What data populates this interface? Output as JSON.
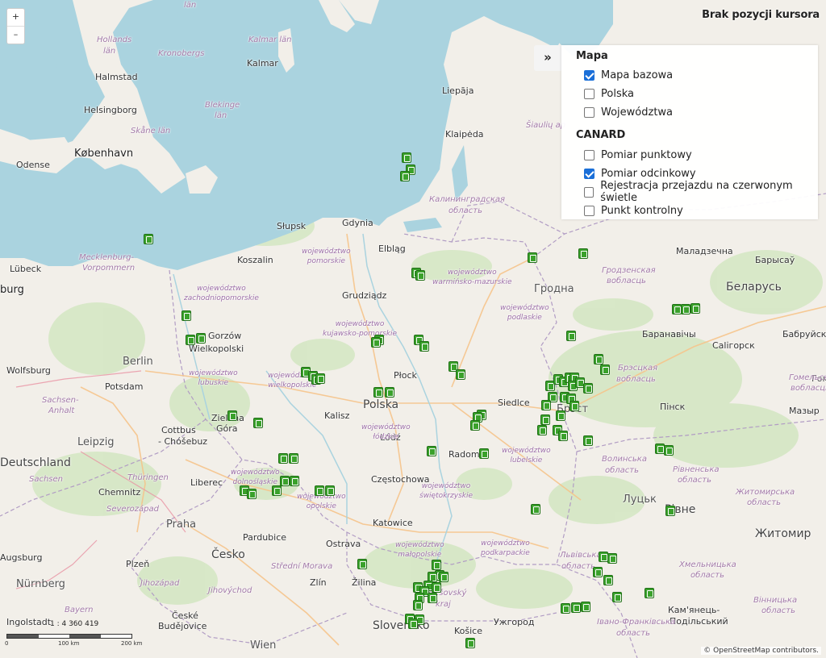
{
  "cursor_info": "Brak pozycji kursora",
  "zoom": {
    "in": "+",
    "out": "–"
  },
  "layer_panel": {
    "toggle": "»",
    "groups": [
      {
        "title": "Mapa",
        "items": [
          {
            "label": "Mapa bazowa",
            "checked": true
          },
          {
            "label": "Polska",
            "checked": false
          },
          {
            "label": "Województwa",
            "checked": false
          }
        ]
      },
      {
        "title": "CANARD",
        "items": [
          {
            "label": "Pomiar punktowy",
            "checked": false
          },
          {
            "label": "Pomiar odcinkowy",
            "checked": true
          },
          {
            "label": "Rejestracja przejazdu na czerwonym świetle",
            "checked": false
          },
          {
            "label": "Punkt kontrolny",
            "checked": false
          }
        ]
      }
    ]
  },
  "scale": {
    "ratio": "1 : 4 360 419",
    "labels": [
      "0",
      "100 km",
      "200 km"
    ]
  },
  "attribution": "© OpenStreetMap contributors.",
  "map_labels": {
    "seas": [
      "Hollands",
      "Kronobergs",
      "Kalmar län",
      "Halmstad",
      "Kalmar",
      "Helsingborg",
      "Blekinge",
      "län",
      "Skåne län",
      "København",
      "Odense",
      "Liepāja",
      "Klaipėda",
      "Šiaulių ap",
      "Калининградская",
      "область",
      "län",
      "län",
      "Lübeck",
      "Mecklenburg-",
      "Vorpommern",
      "burg"
    ],
    "places": [
      "Słupsk",
      "Gdynia",
      "Koszalin",
      "Elbląg",
      "Grudziądz",
      "Płock",
      "Polska",
      "Kalisz",
      "Siedlce",
      "Łódź",
      "Radom",
      "Częstochowa",
      "Katowice",
      "Berlin",
      "Potsdam",
      "Wolfsburg",
      "Zielona",
      "Góra",
      "Cottbus",
      "- Chóšebuz",
      "Leipzig",
      "Chemnitz",
      "Praha",
      "Liberec",
      "Pardubice",
      "Česko",
      "Plzeň",
      "Nürnberg",
      "Ingolstadt",
      "České",
      "Budějovice",
      "Wien",
      "Zlín",
      "Žilina",
      "Slovensko",
      "Košice",
      "Ужгород",
      "Ostrava",
      "Гродна",
      "Маладзечна",
      "Барысаў",
      "Беларусь",
      "Баранавічы",
      "Брэст",
      "Пінск",
      "Мазыр",
      "Луцьк",
      "Рівне",
      "Житомир",
      "Бабруйск",
      "Гомельс",
      "Calігорск",
      "Gorzów",
      "Wielkopolski",
      "Deutschland",
      "Sachsen-",
      "Anhalt",
      "Sachsen",
      "Thüringen",
      "Severozápad",
      "Střední Morava",
      "Jihozápad",
      "Jihovýchod",
      "Bayern",
      "Prešovský",
      "kraj",
      "Львівська",
      "область",
      "Хмельницька",
      "область",
      "Вінницька",
      "область",
      "Кам'янець-",
      "Подільський",
      "Івано-Франківська",
      "область",
      "Житомирська",
      "область",
      "Рівненська",
      "область",
      "Волинська",
      "область",
      "Брэсцкая",
      "вобласць",
      "Гродзенская",
      "вобласць",
      "Гомельская",
      "вобласць",
      "Augsburg"
    ],
    "voivodeships": [
      "województwo pomorskie",
      "województwo zachodniopomorskie",
      "województwo warmińsko-mazurskie",
      "województwo podlaskie",
      "województwo kujawsko-pomorskie",
      "województwo wielkopolskie",
      "województwo lubuskie",
      "województwo łódzkie",
      "województwo lubelskie",
      "województwo dolnośląskie",
      "województwo opolskie",
      "województwo świętokrzyskie",
      "województwo małopolskie",
      "województwo podkarpackie"
    ]
  },
  "markers": {
    "icon": "speed-camera-icon",
    "color": "#3aa12b",
    "positions": [
      [
        18.52,
        54.52
      ],
      [
        18.58,
        54.4
      ],
      [
        18.5,
        54.34
      ],
      [
        14.36,
        53.72
      ],
      [
        20.55,
        53.53
      ],
      [
        21.37,
        53.57
      ],
      [
        18.68,
        53.38
      ],
      [
        18.74,
        53.36
      ],
      [
        14.97,
        52.96
      ],
      [
        15.21,
        52.74
      ],
      [
        15.04,
        52.72
      ],
      [
        18.08,
        52.72
      ],
      [
        18.03,
        52.7
      ],
      [
        18.72,
        52.72
      ],
      [
        18.8,
        52.66
      ],
      [
        21.17,
        52.76
      ],
      [
        22.87,
        53.02
      ],
      [
        23.02,
        53.02
      ],
      [
        23.17,
        53.03
      ],
      [
        21.62,
        52.53
      ],
      [
        21.72,
        52.43
      ],
      [
        16.9,
        52.4
      ],
      [
        17.01,
        52.36
      ],
      [
        17.06,
        52.33
      ],
      [
        17.13,
        52.34
      ],
      [
        18.07,
        52.2
      ],
      [
        18.24,
        52.2
      ],
      [
        19.27,
        52.46
      ],
      [
        19.39,
        52.38
      ],
      [
        20.83,
        52.27
      ],
      [
        20.96,
        52.33
      ],
      [
        21.05,
        52.31
      ],
      [
        21.14,
        52.35
      ],
      [
        21.23,
        52.35
      ],
      [
        21.2,
        52.27
      ],
      [
        21.32,
        52.3
      ],
      [
        21.45,
        52.24
      ],
      [
        20.87,
        52.16
      ],
      [
        21.07,
        52.16
      ],
      [
        20.77,
        52.08
      ],
      [
        21.17,
        52.14
      ],
      [
        21.23,
        52.07
      ],
      [
        21.0,
        51.97
      ],
      [
        20.95,
        51.83
      ],
      [
        19.73,
        51.98
      ],
      [
        19.67,
        51.96
      ],
      [
        19.63,
        51.88
      ],
      [
        20.75,
        51.93
      ],
      [
        20.7,
        51.83
      ],
      [
        21.04,
        51.77
      ],
      [
        21.45,
        51.73
      ],
      [
        22.6,
        51.65
      ],
      [
        22.75,
        51.63
      ],
      [
        15.71,
        51.97
      ],
      [
        16.13,
        51.9
      ],
      [
        16.53,
        51.55
      ],
      [
        16.7,
        51.55
      ],
      [
        18.92,
        51.62
      ],
      [
        19.77,
        51.6
      ],
      [
        15.91,
        51.23
      ],
      [
        16.02,
        51.2
      ],
      [
        16.43,
        51.23
      ],
      [
        16.55,
        51.33
      ],
      [
        16.71,
        51.33
      ],
      [
        17.12,
        51.23
      ],
      [
        17.28,
        51.23
      ],
      [
        20.6,
        51.05
      ],
      [
        22.77,
        51.03
      ],
      [
        21.69,
        50.58
      ],
      [
        21.84,
        50.56
      ],
      [
        21.6,
        50.43
      ],
      [
        21.77,
        50.35
      ],
      [
        21.92,
        50.18
      ],
      [
        22.44,
        50.22
      ],
      [
        17.81,
        50.51
      ],
      [
        19.0,
        50.5
      ],
      [
        19.05,
        50.4
      ],
      [
        18.93,
        50.38
      ],
      [
        19.12,
        50.38
      ],
      [
        18.87,
        50.29
      ],
      [
        19.0,
        50.28
      ],
      [
        18.7,
        50.28
      ],
      [
        18.8,
        50.24
      ],
      [
        18.73,
        50.17
      ],
      [
        18.93,
        50.17
      ],
      [
        18.7,
        50.1
      ],
      [
        18.57,
        49.97
      ],
      [
        18.73,
        49.96
      ],
      [
        18.62,
        49.92
      ],
      [
        21.08,
        50.07
      ],
      [
        21.25,
        50.08
      ],
      [
        21.4,
        50.09
      ],
      [
        19.55,
        49.73
      ],
      [
        21.67,
        49.7
      ],
      [
        21.72,
        49.61
      ]
    ]
  }
}
